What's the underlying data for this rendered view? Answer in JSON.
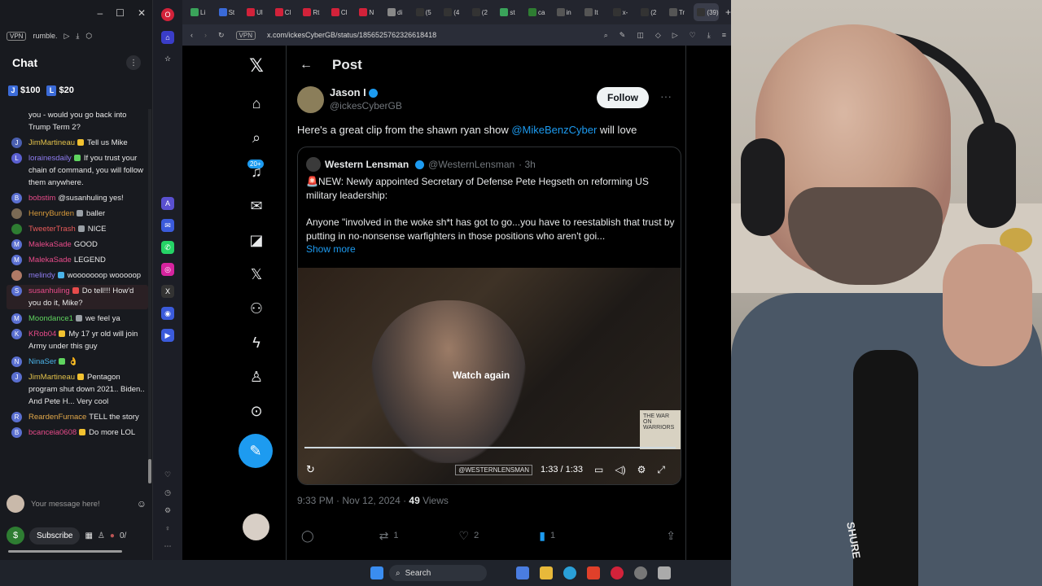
{
  "chat_panel": {
    "tab_label": "rumble.",
    "vpn_label": "VPN",
    "title": "Chat",
    "tips": [
      "$100",
      "$20"
    ],
    "messages": [
      {
        "user": "",
        "text": "you - would you go back into Trump Term 2?",
        "avatar": "",
        "color": "#e8e8e8"
      },
      {
        "user": "JimMartineau",
        "text": "Tell us Mike",
        "avatar": "J",
        "color": "#e2c14a"
      },
      {
        "user": "lorainesdaily",
        "text": "If you trust your chain of command, you will follow them anywhere.",
        "avatar": "L",
        "color": "#8e7cf0"
      },
      {
        "user": "bobstim",
        "text": "@susanhuling yes!",
        "avatar": "B",
        "color": "#e84b8a"
      },
      {
        "user": "HenryBurden",
        "text": "baller",
        "avatar": "",
        "color": "#d89a3a"
      },
      {
        "user": "TweeterTrash",
        "text": "NICE",
        "avatar": "",
        "color": "#e85a5a"
      },
      {
        "user": "MalekaSade",
        "text": "GOOD",
        "avatar": "M",
        "color": "#e84b8a"
      },
      {
        "user": "MalekaSade",
        "text": "LEGEND",
        "avatar": "M",
        "color": "#e84b8a"
      },
      {
        "user": "melindy",
        "text": "wooooooop wooooop",
        "avatar": "",
        "color": "#8e7cf0"
      },
      {
        "user": "susanhuling",
        "text": "Do tell!!! How'd you do it, Mike?",
        "avatar": "S",
        "color": "#e84b8a"
      },
      {
        "user": "Moondance1",
        "text": "we feel ya",
        "avatar": "M",
        "color": "#5fd35f"
      },
      {
        "user": "KRob04",
        "text": "My 17 yr old will join Army under this guy",
        "avatar": "K",
        "color": "#e84b8a"
      },
      {
        "user": "NinaSer",
        "text": "👌",
        "avatar": "N",
        "color": "#4ab3e8"
      },
      {
        "user": "JimMartineau",
        "text": "Pentagon program shut down 2021.. Biden.. And Pete H... Very cool",
        "avatar": "J",
        "color": "#e2c14a"
      },
      {
        "user": "ReardenFurnace",
        "text": "TELL the story",
        "avatar": "R",
        "color": "#e2a84a"
      },
      {
        "user": "bcanceia0608",
        "text": "Do more LOL",
        "avatar": "B",
        "color": "#e84b8a"
      }
    ],
    "input_placeholder": "Your message here!",
    "subscribe_label": "Subscribe",
    "counter": "0/"
  },
  "browser": {
    "url": "x.com/ickesCyberGB/status/1856525762326618418",
    "vpn_label": "VPN",
    "active_tab_label": "(39)",
    "tabs": [
      "Li",
      "St",
      "Ul",
      "Cl",
      "Rt",
      "Cl",
      "N",
      "di",
      "(5",
      "(4",
      "(2",
      "st",
      "ca",
      "in",
      "It",
      "x-",
      "(2",
      "Tr",
      "(39)"
    ]
  },
  "x_nav": {
    "notif_badge": "20+"
  },
  "post": {
    "header_title": "Post",
    "author_name": "Jason I",
    "author_handle": "@ickesCyberGB",
    "follow_label": "Follow",
    "text_before": "Here's a great clip from the shawn ryan show ",
    "mention": "@MikeBenzCyber",
    "text_after": " will love",
    "quote": {
      "name": "Western Lensman",
      "handle": "@WesternLensman",
      "age": "· 3h",
      "paragraph1": "🚨NEW: Newly appointed Secretary of Defense Pete Hegseth on reforming US military leadership:",
      "paragraph2": "Anyone \"involved in the woke sh*t has got to go...you have to reestablish that trust by putting in no-nonsense warfighters in those positions who aren't goi...",
      "show_more": "Show more"
    },
    "video": {
      "overlay": "Watch again",
      "watermark": "@WESTERNLENSMAN",
      "time": "1:33 / 1:33",
      "book_text": "THE WAR ON WARRIORS",
      "progress": 1.0
    },
    "timestamp": "9:33 PM · Nov 12, 2024 · ",
    "views_count": "49",
    "views_label": " Views",
    "replies": "",
    "reposts": "1",
    "likes": "2",
    "bookmarks": "1"
  },
  "taskbar": {
    "search_label": "Search"
  },
  "webcam": {
    "mic_brand": "SHURE"
  }
}
